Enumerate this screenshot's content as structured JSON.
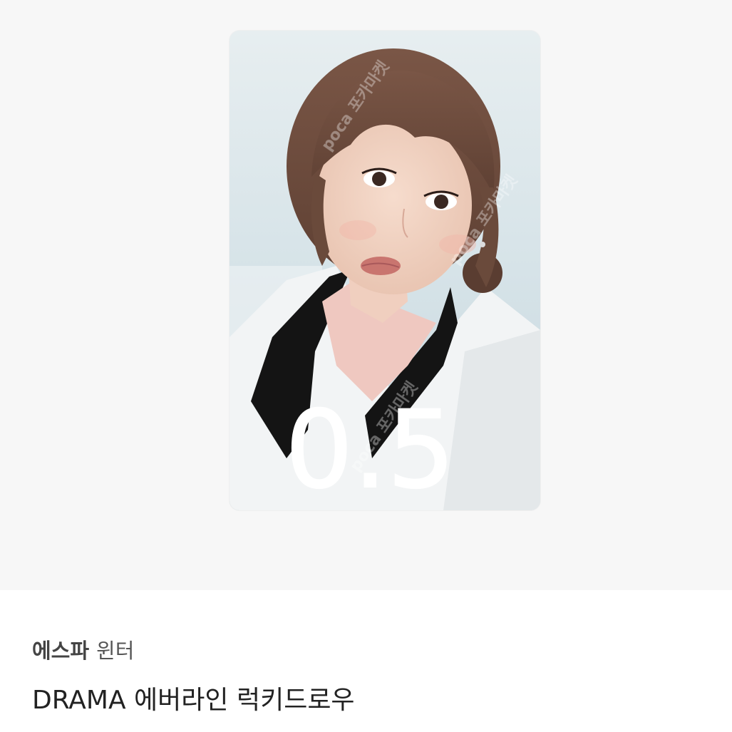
{
  "photocard": {
    "handwritten_price": "0.5",
    "watermark": "poca 포카마켓"
  },
  "item": {
    "group": "에스파",
    "member": "윈터",
    "title": "DRAMA 에버라인 럭키드로우"
  }
}
